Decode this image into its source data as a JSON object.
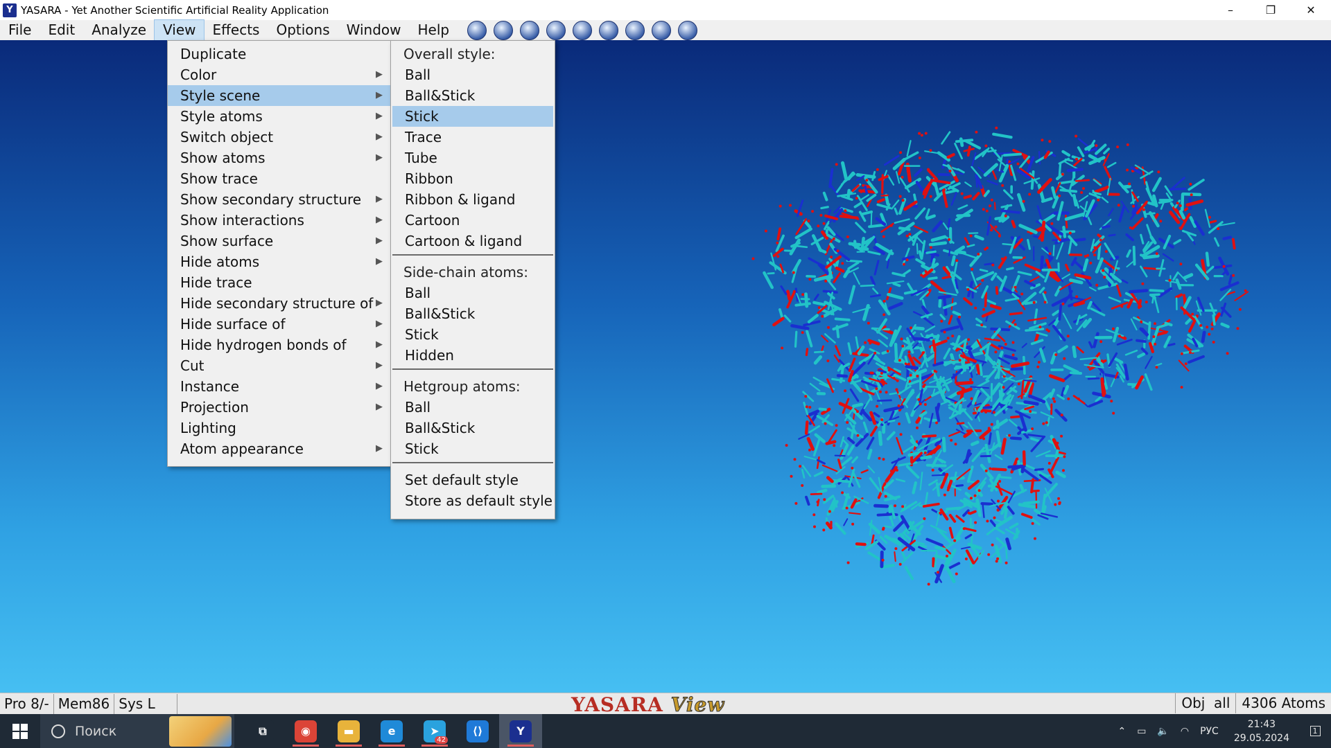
{
  "window": {
    "title": "YASARA - Yet Another Scientific Artificial Reality Application",
    "icon": "Y",
    "controls": {
      "minimize": "–",
      "maximize": "❐",
      "close": "✕"
    }
  },
  "menubar": {
    "menus": [
      "File",
      "Edit",
      "Analyze",
      "View",
      "Effects",
      "Options",
      "Window",
      "Help"
    ],
    "active": "View",
    "toolbar_icons": [
      "display-icon",
      "globe-icon",
      "page-icon",
      "rotate-icon",
      "save-icon",
      "target-icon",
      "rewind-icon",
      "forward-icon",
      "smiley-icon"
    ]
  },
  "view_menu": {
    "items": [
      {
        "label": "Duplicate",
        "submenu": false
      },
      {
        "label": "Color",
        "submenu": true
      },
      {
        "label": "Style scene",
        "submenu": true,
        "highlight": true
      },
      {
        "label": "Style atoms",
        "submenu": true
      },
      {
        "label": "Switch object",
        "submenu": true
      },
      {
        "label": "Show atoms",
        "submenu": true
      },
      {
        "label": "Show trace",
        "submenu": false
      },
      {
        "label": "Show secondary structure",
        "submenu": true
      },
      {
        "label": "Show interactions",
        "submenu": true
      },
      {
        "label": "Show surface",
        "submenu": true
      },
      {
        "label": "Hide atoms",
        "submenu": true
      },
      {
        "label": "Hide trace",
        "submenu": false
      },
      {
        "label": "Hide secondary structure of",
        "submenu": true
      },
      {
        "label": "Hide surface of",
        "submenu": true
      },
      {
        "label": "Hide hydrogen bonds of",
        "submenu": true
      },
      {
        "label": "Cut",
        "submenu": true
      },
      {
        "label": "Instance",
        "submenu": true
      },
      {
        "label": "Projection",
        "submenu": true
      },
      {
        "label": "Lighting",
        "submenu": false
      },
      {
        "label": "Atom appearance",
        "submenu": true
      }
    ]
  },
  "style_submenu": {
    "overall_header": "Overall style:",
    "overall": [
      "Ball",
      "Ball&Stick",
      "Stick",
      "Trace",
      "Tube",
      "Ribbon",
      "Ribbon & ligand",
      "Cartoon",
      "Cartoon & ligand"
    ],
    "overall_selected": "Stick",
    "sidechain_header": "Side-chain atoms:",
    "sidechain": [
      "Ball",
      "Ball&Stick",
      "Stick",
      "Hidden"
    ],
    "hetgroup_header": "Hetgroup atoms:",
    "hetgroup": [
      "Ball",
      "Ball&Stick",
      "Stick"
    ],
    "actions": [
      "Set default style",
      "Store as default style"
    ]
  },
  "statusbar": {
    "left": [
      "Pro 8/-",
      "Mem86",
      "Sys L"
    ],
    "logo_main": "YASARA",
    "logo_sub": "View",
    "obj": "Obj  all",
    "atoms": "4306 Atoms"
  },
  "taskbar": {
    "search_placeholder": "Поиск",
    "apps": [
      {
        "name": "task-view-icon",
        "glyph": "⧉",
        "color": "#1f2a36",
        "running": false
      },
      {
        "name": "chrome-icon",
        "glyph": "◉",
        "color": "#db4437",
        "running": true
      },
      {
        "name": "file-explorer-icon",
        "glyph": "▬",
        "color": "#e8b33b",
        "running": true
      },
      {
        "name": "edge-icon",
        "glyph": "e",
        "color": "#1f8ad8",
        "running": true
      },
      {
        "name": "telegram-icon",
        "glyph": "➤",
        "color": "#2aa2de",
        "running": true,
        "badge": "42"
      },
      {
        "name": "vscode-icon",
        "glyph": "⟨⟩",
        "color": "#1f7ad8",
        "running": false
      },
      {
        "name": "yasara-icon",
        "glyph": "Y",
        "color": "#1b2f8f",
        "running": true,
        "focused": true
      }
    ],
    "tray_lang": "РУС",
    "time": "21:43",
    "date": "29.05.2024",
    "notifications": "1"
  },
  "colors": {
    "menu_highlight": "#a6cbeb",
    "molecule_carbon": "#22c3c7",
    "molecule_oxygen": "#e01010",
    "molecule_nitrogen": "#1a2fd0"
  }
}
